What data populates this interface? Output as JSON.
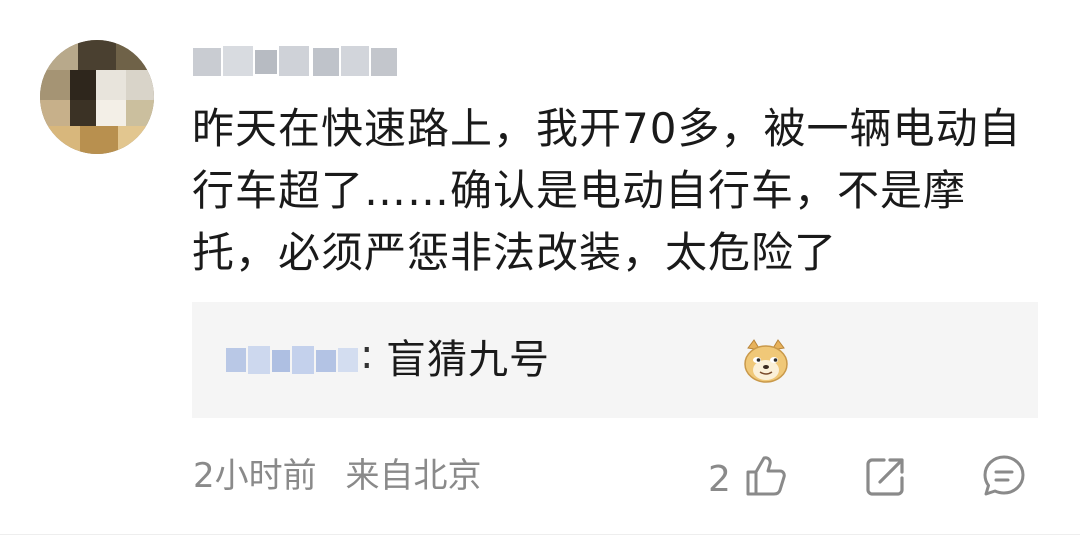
{
  "comment": {
    "username_blurred": true,
    "text": "昨天在快速路上，我开70多，被一辆电动自行车超了……确认是电动自行车，不是摩托，必须严惩非法改装，太危险了"
  },
  "reply": {
    "username_blurred": true,
    "colon": ":",
    "text": "盲猜九号",
    "emoji": "doge-emoji"
  },
  "meta": {
    "time": "2小时前",
    "location": "来自北京"
  },
  "actions": {
    "like_count": "2",
    "like_icon": "thumbs-up-icon",
    "share_icon": "share-icon",
    "comment_icon": "comment-icon"
  },
  "colors": {
    "text": "#1a1a1a",
    "meta": "#8a8a8a",
    "reply_bg": "#f5f5f5"
  }
}
